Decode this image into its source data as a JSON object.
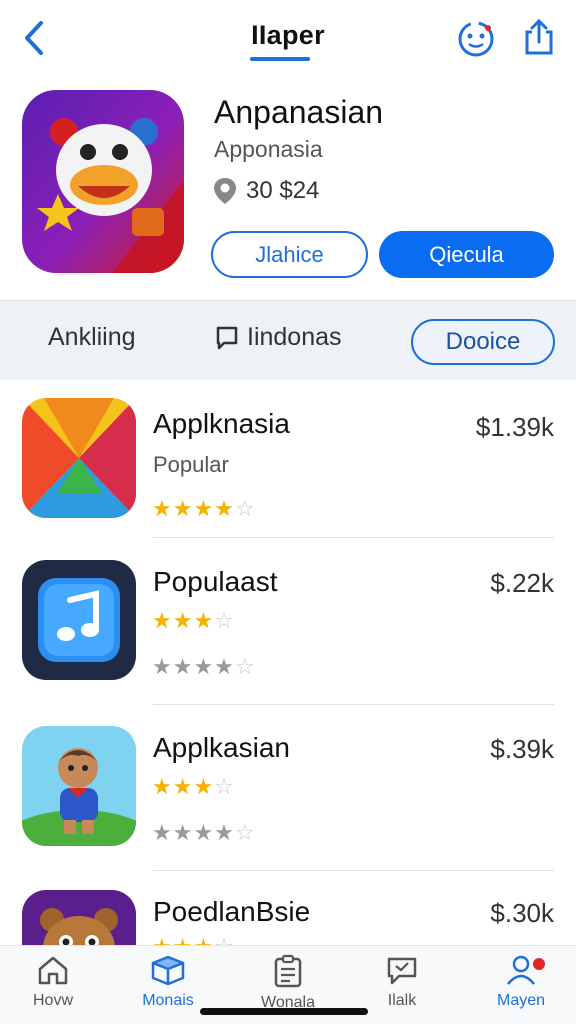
{
  "nav": {
    "title": "IIaper",
    "icons": {
      "back": "chevron-left-icon",
      "profile": "smiley-icon",
      "share": "share-icon"
    },
    "accent": "#1e6fd9"
  },
  "hero": {
    "title": "Anpanasian",
    "subtitle": "Apponasia",
    "meta": "30  $24",
    "meta_icon": "location-pin-icon",
    "button_outline": "Jlahice",
    "button_fill": "Qiecula",
    "icon": "clown-duck-app-icon"
  },
  "tabs": {
    "a": "Ankliing",
    "b": "Iindonas",
    "b_icon": "chat-bubble-icon",
    "c": "Dooice"
  },
  "list": [
    {
      "name": "Applknasia",
      "subtitle": "Popular",
      "price": "$1.39k",
      "rating": 3.5,
      "icon": "colorful-triangle-app-icon"
    },
    {
      "name": "Populaast",
      "price": "$.22k",
      "rating": 3,
      "rating2": 3.5,
      "icon": "music-note-app-icon"
    },
    {
      "name": "Applkasian",
      "price": "$.39k",
      "rating": 3,
      "rating2": 3.5,
      "icon": "cartoon-boy-app-icon"
    },
    {
      "name": "PoedlanBsie",
      "price": "$.30k",
      "rating": 3,
      "icon": "bear-app-icon"
    }
  ],
  "tabbar": [
    {
      "label": "Hovw",
      "icon": "home-icon",
      "active": false
    },
    {
      "label": "Monais",
      "icon": "box-icon",
      "active": true
    },
    {
      "label": "Wonala",
      "icon": "clipboard-icon",
      "active": false
    },
    {
      "label": "Ilalk",
      "icon": "chat-icon",
      "active": false
    },
    {
      "label": "Mayen",
      "icon": "person-icon",
      "active": true,
      "badge": true
    }
  ],
  "colors": {
    "primary": "#0a6cf0",
    "star": "#f3b300",
    "badge": "#e6252a"
  }
}
